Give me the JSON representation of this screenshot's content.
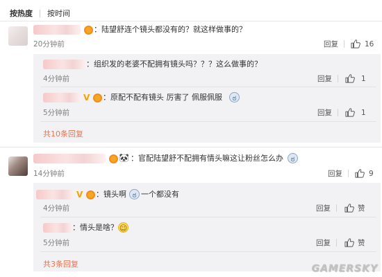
{
  "tabs": {
    "hot": "按热度",
    "time": "按时间"
  },
  "comments": [
    {
      "text": "：陆望舒连个镜头都没有的？就这样做事的？",
      "time": "20分钟前",
      "reply_label": "回复",
      "likes": "16",
      "replies": [
        {
          "text": "：组织发的老婆不配拥有镜头吗？？？这么做事的？",
          "time": "4分钟前",
          "reply_label": "回复",
          "likes": "1"
        },
        {
          "text": "：原配不配有镜头 厉害了 佩服佩服",
          "time": "5分钟前",
          "reply_label": "回复",
          "likes": "1"
        }
      ],
      "more": "共10条回复"
    },
    {
      "text": "：官配陆望舒不配拥有情头嘛这让粉丝怎么办",
      "time": "14分钟前",
      "reply_label": "回复",
      "likes": "9",
      "replies": [
        {
          "text": "：镜头啊",
          "text2": "一个都没有",
          "time": "4分钟前",
          "reply_label": "回复",
          "like_label": "赞"
        },
        {
          "text": "：情头是啥？",
          "time": "5分钟前",
          "reply_label": "回复",
          "like_label": "赞"
        }
      ],
      "more": "共3条回复"
    }
  ],
  "icons": {
    "vip": "vip-badge-icon",
    "verified": "verified-v-icon",
    "emoji_wry": "emoji-wry-face-icon",
    "emoji_smile": "emoji-smile-icon",
    "emoji_panda": "emoji-panda-icon",
    "thumb": "thumbs-up-icon"
  },
  "colors": {
    "accent_orange": "#eb7350",
    "reply_bg": "#f2f2f5",
    "vip_gold": "#f5a623"
  },
  "watermark": "GAMERSKY"
}
